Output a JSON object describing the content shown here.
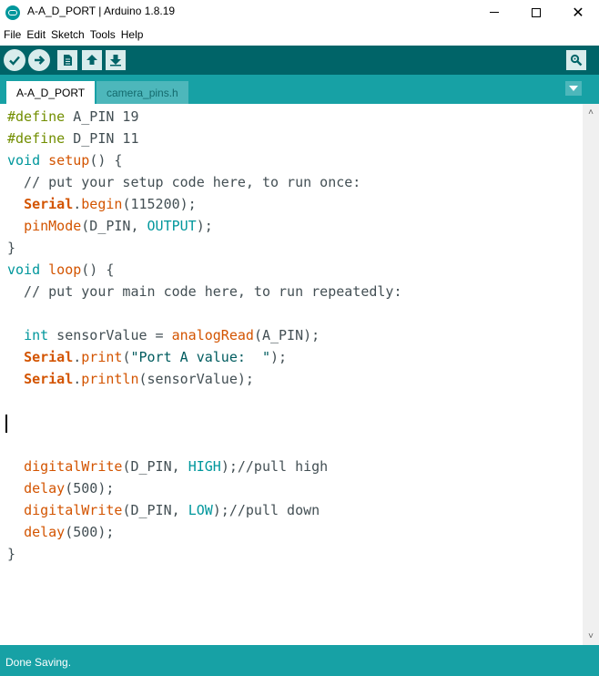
{
  "window": {
    "title": "A-A_D_PORT | Arduino 1.8.19",
    "close_glyph": "✕"
  },
  "menu": [
    "File",
    "Edit",
    "Sketch",
    "Tools",
    "Help"
  ],
  "toolbar": {
    "icons": [
      "verify-icon",
      "upload-icon",
      "new-icon",
      "open-icon",
      "save-icon",
      "serial-monitor-icon"
    ],
    "bg_color": "#006468"
  },
  "tabs": [
    {
      "label": "A-A_D_PORT",
      "active": true
    },
    {
      "label": "camera_pins.h",
      "active": false
    }
  ],
  "code": [
    [
      {
        "t": "#define",
        "c": "define"
      },
      {
        "t": " A_PIN 19"
      }
    ],
    [
      {
        "t": "#define",
        "c": "define"
      },
      {
        "t": " D_PIN 11"
      }
    ],
    [
      {
        "t": "void",
        "c": "type"
      },
      {
        "t": " "
      },
      {
        "t": "setup",
        "c": "func"
      },
      {
        "t": "() {"
      }
    ],
    [
      {
        "t": "  // put your setup code here, to run once:",
        "c": "cmt"
      }
    ],
    [
      {
        "t": "  "
      },
      {
        "t": "Serial",
        "c": "serial"
      },
      {
        "t": "."
      },
      {
        "t": "begin",
        "c": "func"
      },
      {
        "t": "(115200);"
      }
    ],
    [
      {
        "t": "  "
      },
      {
        "t": "pinMode",
        "c": "func"
      },
      {
        "t": "(D_PIN, "
      },
      {
        "t": "OUTPUT",
        "c": "const"
      },
      {
        "t": ");"
      }
    ],
    [
      {
        "t": "}"
      }
    ],
    [
      {
        "t": "void",
        "c": "type"
      },
      {
        "t": " "
      },
      {
        "t": "loop",
        "c": "func"
      },
      {
        "t": "() {"
      }
    ],
    [
      {
        "t": "  // put your main code here, to run repeatedly:",
        "c": "cmt"
      }
    ],
    [],
    [
      {
        "t": "  "
      },
      {
        "t": "int",
        "c": "type"
      },
      {
        "t": " sensorValue = "
      },
      {
        "t": "analogRead",
        "c": "func"
      },
      {
        "t": "(A_PIN);"
      }
    ],
    [
      {
        "t": "  "
      },
      {
        "t": "Serial",
        "c": "serial"
      },
      {
        "t": "."
      },
      {
        "t": "print",
        "c": "func"
      },
      {
        "t": "("
      },
      {
        "t": "\"Port A value:  \"",
        "c": "str"
      },
      {
        "t": ");"
      }
    ],
    [
      {
        "t": "  "
      },
      {
        "t": "Serial",
        "c": "serial"
      },
      {
        "t": "."
      },
      {
        "t": "println",
        "c": "func"
      },
      {
        "t": "(sensorValue);"
      }
    ],
    [],
    [
      {
        "caret": true
      }
    ],
    [],
    [
      {
        "t": "  "
      },
      {
        "t": "digitalWrite",
        "c": "func"
      },
      {
        "t": "(D_PIN, "
      },
      {
        "t": "HIGH",
        "c": "const"
      },
      {
        "t": ");//pull high"
      }
    ],
    [
      {
        "t": "  "
      },
      {
        "t": "delay",
        "c": "func"
      },
      {
        "t": "(500);"
      }
    ],
    [
      {
        "t": "  "
      },
      {
        "t": "digitalWrite",
        "c": "func"
      },
      {
        "t": "(D_PIN, "
      },
      {
        "t": "LOW",
        "c": "const"
      },
      {
        "t": ");//pull down"
      }
    ],
    [
      {
        "t": "  "
      },
      {
        "t": "delay",
        "c": "func"
      },
      {
        "t": "(500);"
      }
    ],
    [
      {
        "t": "}"
      }
    ]
  ],
  "colors": {
    "define": "#728e00",
    "type": "#00979c",
    "func": "#d35400",
    "const": "#00979c",
    "serial": "#d35400",
    "str": "#005c5f",
    "cmt": "#434f54"
  },
  "status": {
    "text": "Done Saving."
  },
  "scrollbar": {
    "up_arrow": "˄",
    "down_arrow": "˅"
  }
}
